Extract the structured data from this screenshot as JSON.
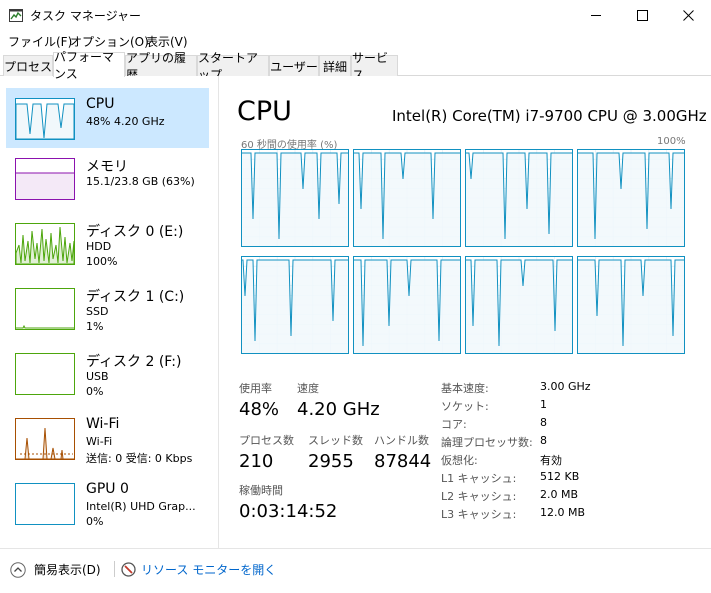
{
  "window": {
    "title": "タスク マネージャー"
  },
  "menu": [
    "ファイル(F)",
    "オプション(O)",
    "表示(V)"
  ],
  "tabs": [
    {
      "label": "プロセス",
      "active": false
    },
    {
      "label": "パフォーマンス",
      "active": true
    },
    {
      "label": "アプリの履歴",
      "active": false
    },
    {
      "label": "スタートアップ",
      "active": false
    },
    {
      "label": "ユーザー",
      "active": false
    },
    {
      "label": "詳細",
      "active": false
    },
    {
      "label": "サービス",
      "active": false
    }
  ],
  "sidebar": [
    {
      "title": "CPU",
      "sub1": "48%  4.20 GHz",
      "sub2": "",
      "color": "#1191c1",
      "selected": true
    },
    {
      "title": "メモリ",
      "sub1": "15.1/23.8 GB (63%)",
      "sub2": "",
      "color": "#8b12ae",
      "selected": false
    },
    {
      "title": "ディスク 0 (E:)",
      "sub1": "HDD",
      "sub2": "100%",
      "color": "#4da60c",
      "selected": false
    },
    {
      "title": "ディスク 1 (C:)",
      "sub1": "SSD",
      "sub2": "1%",
      "color": "#4da60c",
      "selected": false
    },
    {
      "title": "ディスク 2 (F:)",
      "sub1": "USB",
      "sub2": "0%",
      "color": "#4da60c",
      "selected": false
    },
    {
      "title": "Wi-Fi",
      "sub1": "Wi-Fi",
      "sub2": "送信: 0  受信: 0 Kbps",
      "color": "#a74f01",
      "selected": false
    },
    {
      "title": "GPU 0",
      "sub1": "Intel(R) UHD Grap...",
      "sub2": "0%",
      "color": "#1191c1",
      "selected": false
    }
  ],
  "cpu": {
    "heading": "CPU",
    "model": "Intel(R) Core(TM) i7-9700 CPU @ 3.00GHz",
    "graph_label": "60 秒間の使用率 (%)",
    "graph_max": "100%",
    "stats": [
      {
        "label": "使用率",
        "value": "48%"
      },
      {
        "label": "速度",
        "value": "4.20 GHz"
      },
      {
        "label": "プロセス数",
        "value": "210"
      },
      {
        "label": "スレッド数",
        "value": "2955"
      },
      {
        "label": "ハンドル数",
        "value": "87844"
      },
      {
        "label": "稼働時間",
        "value": "0:03:14:52"
      }
    ],
    "specs": [
      {
        "label": "基本速度:",
        "value": "3.00 GHz"
      },
      {
        "label": "ソケット:",
        "value": "1"
      },
      {
        "label": "コア:",
        "value": "8"
      },
      {
        "label": "論理プロセッサ数:",
        "value": "8"
      },
      {
        "label": "仮想化:",
        "value": "有効"
      },
      {
        "label": "L1 キャッシュ:",
        "value": "512 KB"
      },
      {
        "label": "L2 キャッシュ:",
        "value": "2.0 MB"
      },
      {
        "label": "L3 キャッシュ:",
        "value": "12.0 MB"
      }
    ]
  },
  "footer": {
    "fewer_details": "簡易表示(D)",
    "resource_monitor": "リソース モニターを開く"
  },
  "colors": {
    "cpu_line": "#1191c1",
    "cpu_fill": "#f1f8fb",
    "grid": "#d9eaf4",
    "selected_bg": "#cce8ff"
  }
}
